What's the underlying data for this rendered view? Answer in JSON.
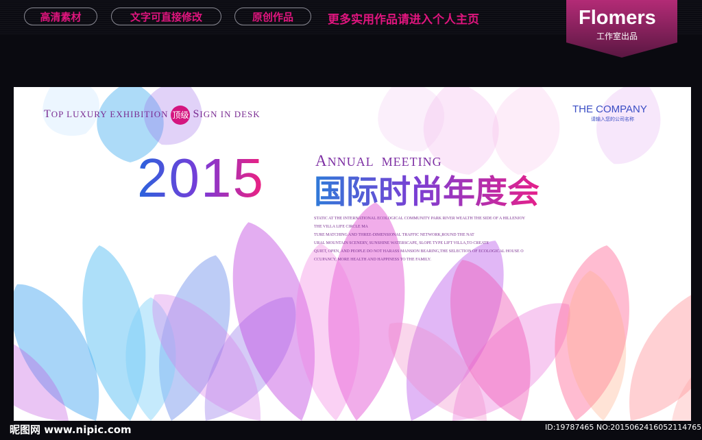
{
  "header": {
    "tags": [
      "高清素材",
      "文字可直接修改",
      "原创作品"
    ],
    "promo": "更多实用作品请进入个人主页",
    "brand_name": "Flomers",
    "brand_sub": "工作室出品"
  },
  "poster": {
    "tagline_words": [
      "T",
      "OP",
      "LUXURY",
      "EXHIBITION",
      "S",
      "IGN",
      "IN",
      "DESK"
    ],
    "badge": "顶级",
    "company": "THE COMPANY",
    "company_sub": "请输入您的公司名称",
    "year": "2015",
    "annual_first": "A",
    "annual_rest": "NNUAL",
    "annual_second": "MEETING",
    "title_cn": "国际时尚年度会",
    "description": [
      "STATIC AT THE INTERNATIONAL ECOLOGICAL COMMUNITY PARK RIVER WEALTH THE SIDE OF A HILLENJOY",
      "THE VILLA LIFE CIRCLE MA",
      "TURE MATCHING AND THREE-DIMENSIONAL TRAFFIC NETWORK,ROUND THE NAT",
      "URAL MOUNTAIN SCENERY, SUNSHINE WATERSCAPE, SLOPE TYPE LIFT VILLA,TO CREATE",
      "QUIET, OPEN, AND PEOPLE DO NOT HARASS MANSION BEARING,THE SELECTION OF ECOLOGICAL HOUSE O",
      "CCUPANCY, MORE HEALTH AND HAPPINESS TO THE FAMILY."
    ]
  },
  "footer": {
    "watermark": "昵图网 www.nipic.com",
    "id_text": "ID:19787465 NO:20150624160521147655"
  },
  "colors": {
    "accent_pink": "#e0157e",
    "accent_blue": "#2a64dc",
    "accent_purple": "#7d2fa3"
  }
}
